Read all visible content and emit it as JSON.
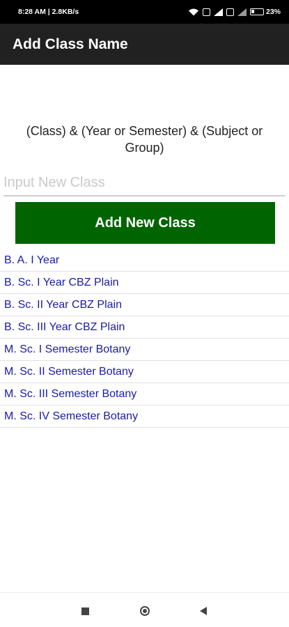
{
  "status_bar": {
    "time_speed": "8:28 AM | 2.8KB/s",
    "battery_percent": "23%",
    "icons": [
      "wifi-icon",
      "volte-icon",
      "signal-icon",
      "volte-icon",
      "signal-icon",
      "battery-icon"
    ]
  },
  "app_bar": {
    "title": "Add Class Name"
  },
  "instructions": "(Class)  & (Year or Semester)  & (Subject or Group)",
  "input": {
    "placeholder": "Input New Class",
    "value": ""
  },
  "add_button": {
    "label": "Add New Class",
    "color": "#006400"
  },
  "classes": [
    "B. A. I Year",
    "B. Sc. I Year CBZ Plain",
    "B. Sc. II Year CBZ Plain",
    "B. Sc. III Year CBZ Plain",
    "M. Sc. I Semester Botany",
    "M. Sc. II Semester Botany",
    "M. Sc. III Semester Botany",
    "M. Sc. IV Semester Botany"
  ],
  "nav_bar": {
    "icons": [
      "recents-square-icon",
      "home-circle-icon",
      "back-triangle-icon"
    ]
  },
  "colors": {
    "app_bar": "#212121",
    "list_text": "#1a1aa6"
  }
}
